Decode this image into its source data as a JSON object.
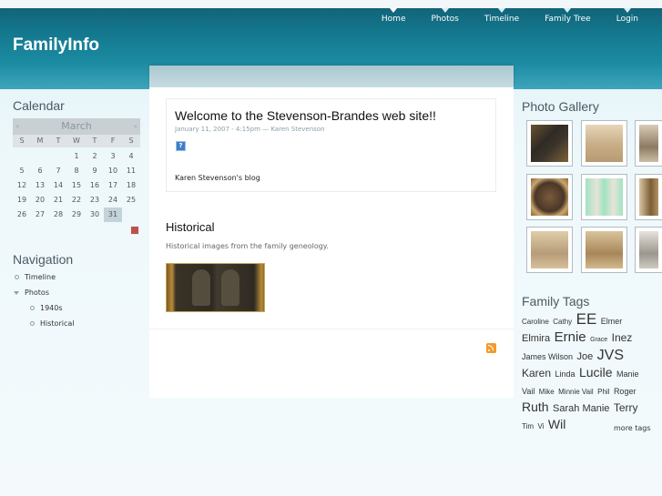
{
  "site": {
    "title": "FamilyInfo"
  },
  "topnav": [
    {
      "label": "Home"
    },
    {
      "label": "Photos"
    },
    {
      "label": "Timeline"
    },
    {
      "label": "Family Tree"
    },
    {
      "label": "Login"
    }
  ],
  "calendar": {
    "title": "Calendar",
    "month": "March",
    "prev_arrow": "«",
    "next_arrow": "»",
    "weekdays": [
      "S",
      "M",
      "T",
      "W",
      "T",
      "F",
      "S"
    ],
    "weeks": [
      [
        "",
        "",
        "",
        "1",
        "2",
        "3",
        "4"
      ],
      [
        "5",
        "6",
        "7",
        "8",
        "9",
        "10",
        "11"
      ],
      [
        "12",
        "13",
        "14",
        "15",
        "16",
        "17",
        "18"
      ],
      [
        "19",
        "20",
        "21",
        "22",
        "23",
        "24",
        "25"
      ],
      [
        "26",
        "27",
        "28",
        "29",
        "30",
        "31",
        ""
      ]
    ],
    "highlighted_day": "31"
  },
  "navigation": {
    "title": "Navigation",
    "items": [
      {
        "label": "Timeline"
      },
      {
        "label": "Photos"
      },
      {
        "label": "1940s"
      },
      {
        "label": "Historical"
      }
    ]
  },
  "post": {
    "title": "Welcome to the Stevenson-Brandes web site!!",
    "meta": "January 11, 2007 - 4:15pm — Karen Stevenson",
    "icon_glyph": "?",
    "blog_link": "Karen Stevenson's blog"
  },
  "section": {
    "title": "Historical",
    "description": "Historical images from the family geneology."
  },
  "gallery": {
    "title": "Photo Gallery"
  },
  "tags": {
    "title": "Family Tags",
    "items": [
      {
        "label": "Caroline",
        "size": 8
      },
      {
        "label": "Cathy",
        "size": 8
      },
      {
        "label": "EE",
        "size": 17
      },
      {
        "label": "Elmer",
        "size": 9
      },
      {
        "label": "Elmira",
        "size": 11
      },
      {
        "label": "Ernie",
        "size": 15
      },
      {
        "label": "Grace",
        "size": 7
      },
      {
        "label": "Inez",
        "size": 12
      },
      {
        "label": "James Wilson",
        "size": 9
      },
      {
        "label": "Joe",
        "size": 11
      },
      {
        "label": "JVS",
        "size": 16
      },
      {
        "label": "Karen",
        "size": 12
      },
      {
        "label": "Linda",
        "size": 9
      },
      {
        "label": "Lucile",
        "size": 14
      },
      {
        "label": "Manie Vail",
        "size": 9
      },
      {
        "label": "Mike",
        "size": 8
      },
      {
        "label": "Minnie Vail",
        "size": 8
      },
      {
        "label": "Phil",
        "size": 8
      },
      {
        "label": "Roger",
        "size": 9
      },
      {
        "label": "Ruth",
        "size": 14
      },
      {
        "label": "Sarah Manie",
        "size": 11
      },
      {
        "label": "Terry",
        "size": 12
      },
      {
        "label": "Tim",
        "size": 8
      },
      {
        "label": "Vi",
        "size": 8
      },
      {
        "label": "Wil",
        "size": 14
      }
    ],
    "more_label": "more tags"
  },
  "colors": {
    "header": "#147a90",
    "accent": "#3ea5bb"
  }
}
